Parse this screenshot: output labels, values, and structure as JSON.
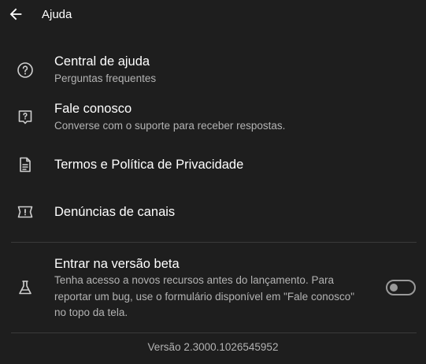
{
  "header": {
    "title": "Ajuda",
    "back_icon": "arrow-left-icon"
  },
  "items": [
    {
      "icon": "help-circle-icon",
      "title": "Central de ajuda",
      "subtitle": "Perguntas frequentes"
    },
    {
      "icon": "feedback-question-icon",
      "title": "Fale conosco",
      "subtitle": "Converse com o suporte para receber respostas."
    },
    {
      "icon": "document-icon",
      "title": "Termos e Política de Privacidade"
    },
    {
      "icon": "report-icon",
      "title": "Denúncias de canais"
    }
  ],
  "beta": {
    "icon": "flask-icon",
    "title": "Entrar na versão beta",
    "description": "Tenha acesso a novos recursos antes do lançamento. Para\nreportar um bug,  use o formulário disponível em \"Fale conosco\"\nno topo da tela.",
    "enabled": false
  },
  "version": "Versão 2.3000.1026545952",
  "colors": {
    "background": "#1e1e1e",
    "text_primary": "#ffffff",
    "text_secondary": "#b3b3b3",
    "divider": "#3a3a3a",
    "toggle_off": "#9a9a9a"
  }
}
